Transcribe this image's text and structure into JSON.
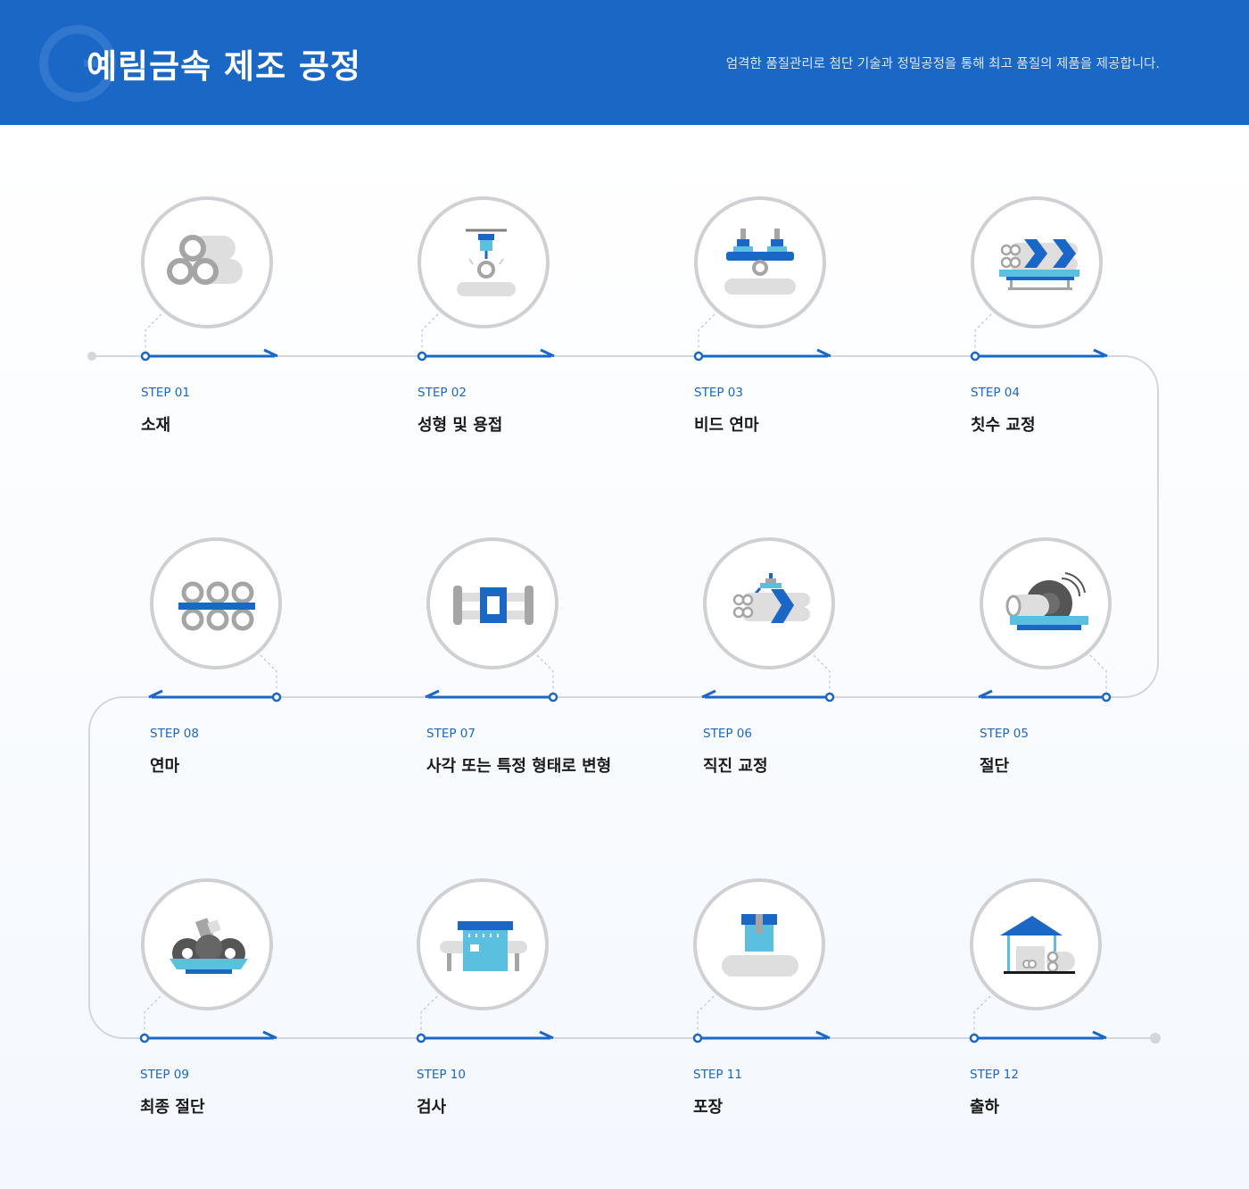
{
  "header": {
    "title": "예림금속 제조 공정",
    "subtitle": "엄격한 품질관리로 첨단 기술과 정밀공정을 통해 최고 품질의 제품을 제공합니다."
  },
  "colors": {
    "primary": "#1b67c5",
    "light_blue": "#5bbfe0",
    "gray_line": "#d3d6db",
    "icon_gray": "#a5a5a5",
    "text_dark": "#1a1a1a"
  },
  "steps": [
    {
      "label": "STEP 01",
      "name": "소재",
      "icon": "pipe-stack-icon"
    },
    {
      "label": "STEP 02",
      "name": "성형 및 용접",
      "icon": "welding-icon"
    },
    {
      "label": "STEP 03",
      "name": "비드 연마",
      "icon": "bead-grinding-icon"
    },
    {
      "label": "STEP 04",
      "name": "칫수 교정",
      "icon": "dimension-correction-icon"
    },
    {
      "label": "STEP 05",
      "name": "절단",
      "icon": "cutting-saw-icon"
    },
    {
      "label": "STEP 06",
      "name": "직진 교정",
      "icon": "straightening-icon"
    },
    {
      "label": "STEP 07",
      "name": "사각 또는 특정 형태로 변형",
      "icon": "shaping-press-icon"
    },
    {
      "label": "STEP 08",
      "name": "연마",
      "icon": "polishing-icon"
    },
    {
      "label": "STEP 09",
      "name": "최종 절단",
      "icon": "final-cutting-icon"
    },
    {
      "label": "STEP 10",
      "name": "검사",
      "icon": "inspection-icon"
    },
    {
      "label": "STEP 11",
      "name": "포장",
      "icon": "packaging-icon"
    },
    {
      "label": "STEP 12",
      "name": "출하",
      "icon": "shipping-warehouse-icon"
    }
  ]
}
